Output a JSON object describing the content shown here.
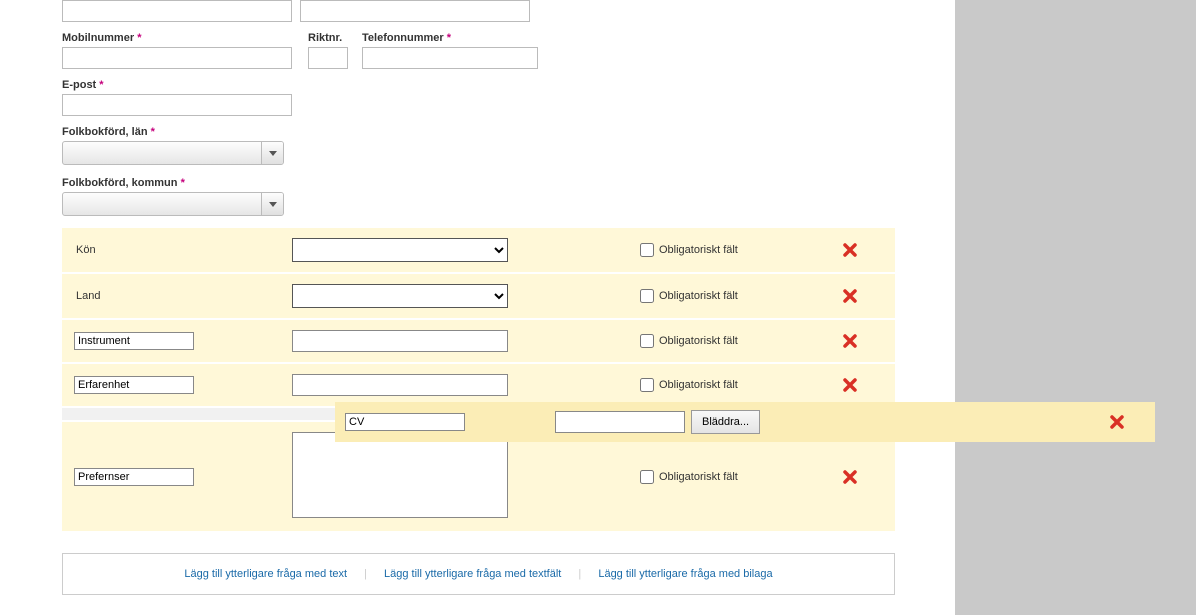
{
  "fields": {
    "mobile_label": "Mobilnummer",
    "riktnr_label": "Riktnr.",
    "telefon_label": "Telefonnummer",
    "epost_label": "E-post",
    "lan_label": "Folkbokförd, län",
    "kommun_label": "Folkbokförd, kommun",
    "required_star": "*"
  },
  "custom_rows": {
    "kon_label": "Kön",
    "land_label": "Land",
    "instrument_value": "Instrument",
    "erfarenhet_value": "Erfarenhet",
    "prefernser_value": "Prefernser",
    "obligatoriskt_label": "Obligatoriskt fält"
  },
  "attachment": {
    "name_value": "CV",
    "browse_label": "Bläddra..."
  },
  "footer": {
    "link_text": "Lägg till ytterligare fråga med text",
    "link_textfield": "Lägg till ytterligare fråga med textfält",
    "link_bilaga": "Lägg till ytterligare fråga med bilaga"
  }
}
